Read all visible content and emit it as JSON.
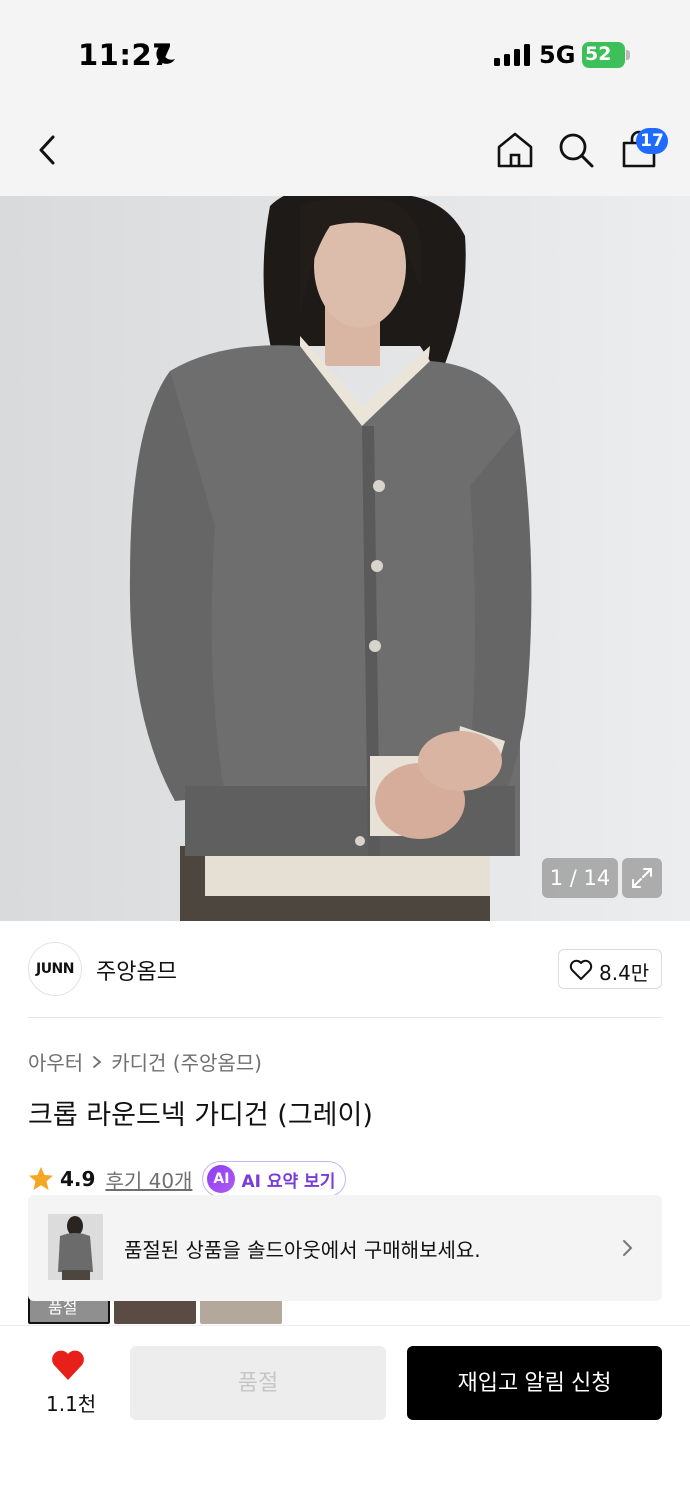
{
  "status_bar": {
    "time": "11:27",
    "network": "5G",
    "battery": "52"
  },
  "nav": {
    "cart_count": "17"
  },
  "image": {
    "counter": "1 / 14"
  },
  "brand": {
    "logo_text": "JUNN",
    "name": "주앙옴므",
    "likes": "8.4만"
  },
  "product": {
    "breadcrumb": [
      "아우터",
      "카디건 (주앙옴므)"
    ],
    "title": "크롭 라운드넥 가디건 (그레이)",
    "rating": "4.9",
    "reviews": "후기 40개",
    "ai_badge": "AI",
    "ai_label": "AI 요약 보기"
  },
  "soldout_banner": {
    "text": "품절된 상품을 솔드아웃에서 구매해보세요."
  },
  "options": {
    "first_thumb_label": "품절"
  },
  "bottom": {
    "wish_count": "1.1천",
    "soldout_label": "품절",
    "restock_label": "재입고 알림 신청"
  },
  "colors": {
    "accent_blue": "#1f6bff",
    "heart_red": "#e8201a",
    "ai_purple": "#7a3bd6"
  }
}
